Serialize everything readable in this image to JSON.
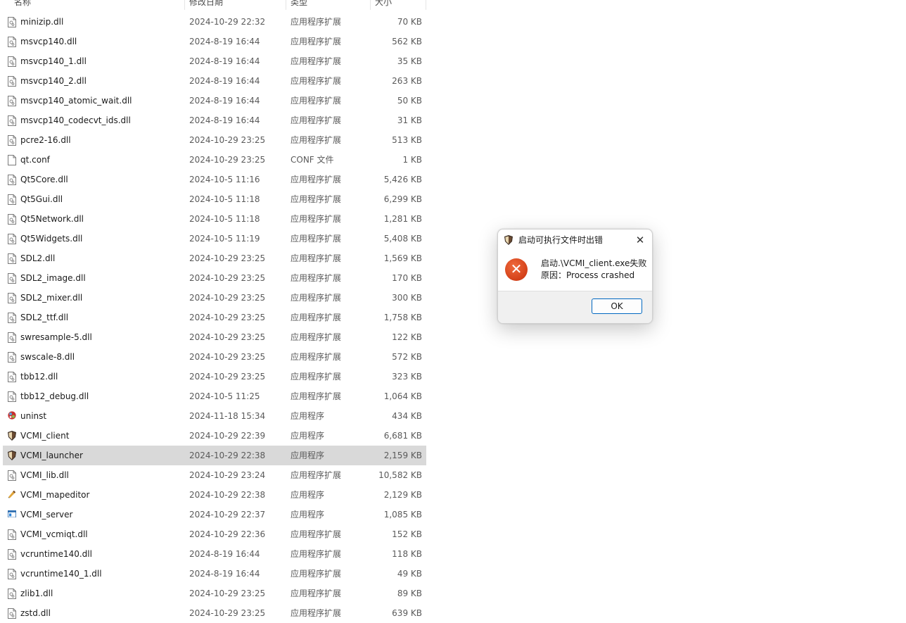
{
  "columns": {
    "name": "名称",
    "date": "修改日期",
    "type": "类型",
    "size": "大小"
  },
  "files": [
    {
      "name": "minizip.dll",
      "date": "2024-10-29 22:32",
      "type": "应用程序扩展",
      "size": "70 KB",
      "icon": "dll-file-icon"
    },
    {
      "name": "msvcp140.dll",
      "date": "2024-8-19 16:44",
      "type": "应用程序扩展",
      "size": "562 KB",
      "icon": "dll-file-icon"
    },
    {
      "name": "msvcp140_1.dll",
      "date": "2024-8-19 16:44",
      "type": "应用程序扩展",
      "size": "35 KB",
      "icon": "dll-file-icon"
    },
    {
      "name": "msvcp140_2.dll",
      "date": "2024-8-19 16:44",
      "type": "应用程序扩展",
      "size": "263 KB",
      "icon": "dll-file-icon"
    },
    {
      "name": "msvcp140_atomic_wait.dll",
      "date": "2024-8-19 16:44",
      "type": "应用程序扩展",
      "size": "50 KB",
      "icon": "dll-file-icon"
    },
    {
      "name": "msvcp140_codecvt_ids.dll",
      "date": "2024-8-19 16:44",
      "type": "应用程序扩展",
      "size": "31 KB",
      "icon": "dll-file-icon"
    },
    {
      "name": "pcre2-16.dll",
      "date": "2024-10-29 23:25",
      "type": "应用程序扩展",
      "size": "513 KB",
      "icon": "dll-file-icon"
    },
    {
      "name": "qt.conf",
      "date": "2024-10-29 23:25",
      "type": "CONF 文件",
      "size": "1 KB",
      "icon": "blank-file-icon"
    },
    {
      "name": "Qt5Core.dll",
      "date": "2024-10-5 11:16",
      "type": "应用程序扩展",
      "size": "5,426 KB",
      "icon": "dll-file-icon"
    },
    {
      "name": "Qt5Gui.dll",
      "date": "2024-10-5 11:18",
      "type": "应用程序扩展",
      "size": "6,299 KB",
      "icon": "dll-file-icon"
    },
    {
      "name": "Qt5Network.dll",
      "date": "2024-10-5 11:18",
      "type": "应用程序扩展",
      "size": "1,281 KB",
      "icon": "dll-file-icon"
    },
    {
      "name": "Qt5Widgets.dll",
      "date": "2024-10-5 11:19",
      "type": "应用程序扩展",
      "size": "5,408 KB",
      "icon": "dll-file-icon"
    },
    {
      "name": "SDL2.dll",
      "date": "2024-10-29 23:25",
      "type": "应用程序扩展",
      "size": "1,569 KB",
      "icon": "dll-file-icon"
    },
    {
      "name": "SDL2_image.dll",
      "date": "2024-10-29 23:25",
      "type": "应用程序扩展",
      "size": "170 KB",
      "icon": "dll-file-icon"
    },
    {
      "name": "SDL2_mixer.dll",
      "date": "2024-10-29 23:25",
      "type": "应用程序扩展",
      "size": "300 KB",
      "icon": "dll-file-icon"
    },
    {
      "name": "SDL2_ttf.dll",
      "date": "2024-10-29 23:25",
      "type": "应用程序扩展",
      "size": "1,758 KB",
      "icon": "dll-file-icon"
    },
    {
      "name": "swresample-5.dll",
      "date": "2024-10-29 23:25",
      "type": "应用程序扩展",
      "size": "122 KB",
      "icon": "dll-file-icon"
    },
    {
      "name": "swscale-8.dll",
      "date": "2024-10-29 23:25",
      "type": "应用程序扩展",
      "size": "572 KB",
      "icon": "dll-file-icon"
    },
    {
      "name": "tbb12.dll",
      "date": "2024-10-29 23:25",
      "type": "应用程序扩展",
      "size": "323 KB",
      "icon": "dll-file-icon"
    },
    {
      "name": "tbb12_debug.dll",
      "date": "2024-10-5 11:25",
      "type": "应用程序扩展",
      "size": "1,064 KB",
      "icon": "dll-file-icon"
    },
    {
      "name": "uninst",
      "date": "2024-11-18 15:34",
      "type": "应用程序",
      "size": "434 KB",
      "icon": "uninstaller-icon"
    },
    {
      "name": "VCMI_client",
      "date": "2024-10-29 22:39",
      "type": "应用程序",
      "size": "6,681 KB",
      "icon": "vcmi-shield-icon"
    },
    {
      "name": "VCMI_launcher",
      "date": "2024-10-29 22:38",
      "type": "应用程序",
      "size": "2,159 KB",
      "icon": "vcmi-shield-icon",
      "selected": true
    },
    {
      "name": "VCMI_lib.dll",
      "date": "2024-10-29 23:24",
      "type": "应用程序扩展",
      "size": "10,582 KB",
      "icon": "dll-file-icon"
    },
    {
      "name": "VCMI_mapeditor",
      "date": "2024-10-29 22:38",
      "type": "应用程序",
      "size": "2,129 KB",
      "icon": "mapeditor-icon"
    },
    {
      "name": "VCMI_server",
      "date": "2024-10-29 22:37",
      "type": "应用程序",
      "size": "1,085 KB",
      "icon": "server-window-icon"
    },
    {
      "name": "VCMI_vcmiqt.dll",
      "date": "2024-10-29 22:36",
      "type": "应用程序扩展",
      "size": "152 KB",
      "icon": "dll-file-icon"
    },
    {
      "name": "vcruntime140.dll",
      "date": "2024-8-19 16:44",
      "type": "应用程序扩展",
      "size": "118 KB",
      "icon": "dll-file-icon"
    },
    {
      "name": "vcruntime140_1.dll",
      "date": "2024-8-19 16:44",
      "type": "应用程序扩展",
      "size": "49 KB",
      "icon": "dll-file-icon"
    },
    {
      "name": "zlib1.dll",
      "date": "2024-10-29 23:25",
      "type": "应用程序扩展",
      "size": "89 KB",
      "icon": "dll-file-icon"
    },
    {
      "name": "zstd.dll",
      "date": "2024-10-29 23:25",
      "type": "应用程序扩展",
      "size": "639 KB",
      "icon": "dll-file-icon"
    }
  ],
  "dialog": {
    "title": "启动可执行文件时出错",
    "close_glyph": "✕",
    "error_glyph": "✕",
    "message_line1": "启动.\\VCMI_client.exe失败",
    "message_line2": "原因：Process crashed",
    "ok_label": "OK",
    "title_icon": "vcmi-shield-icon",
    "error_icon": "error-circle-icon"
  },
  "colors": {
    "selection": "#d9d9d9",
    "error": "#d93b13",
    "ok_border": "#0067c0"
  }
}
